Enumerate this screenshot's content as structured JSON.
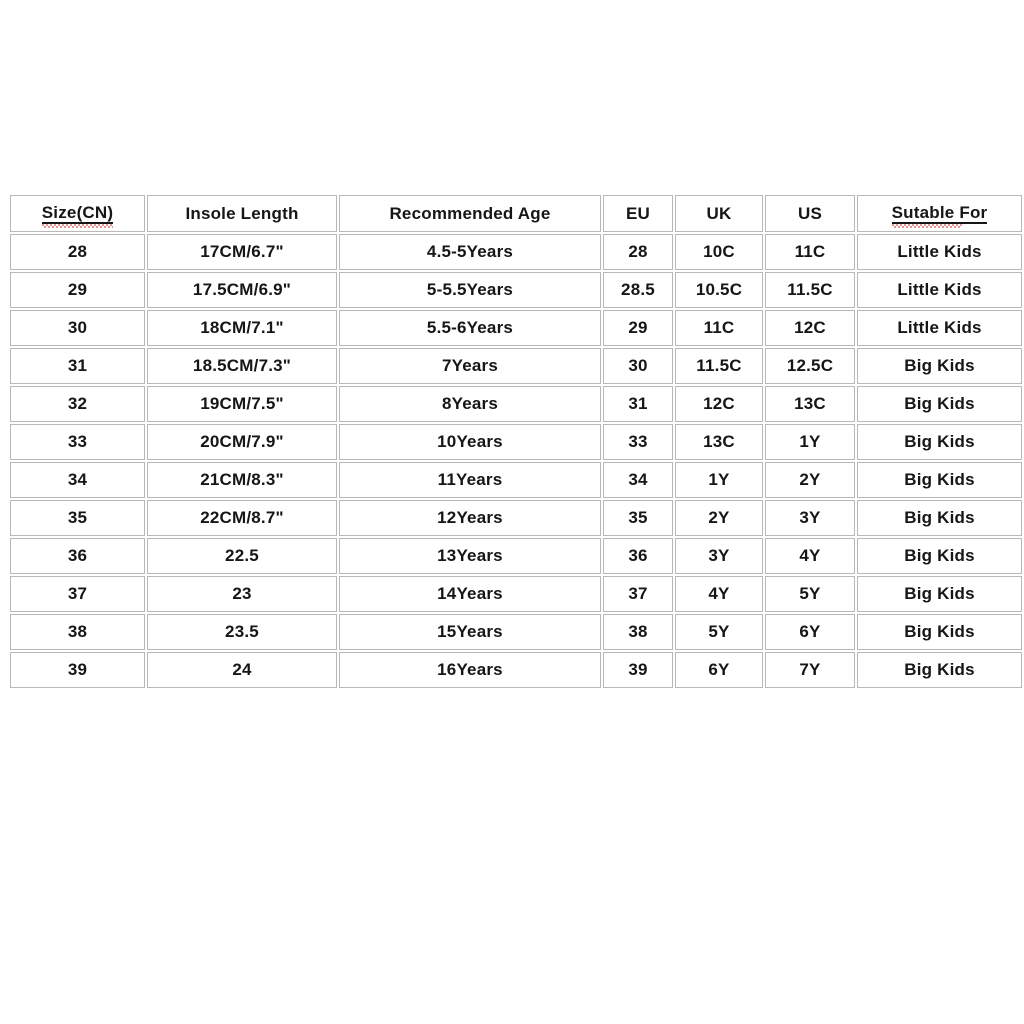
{
  "table": {
    "name": "shoe-size-conversion-chart",
    "columns": [
      {
        "key": "size_cn",
        "label": "Size(CN)",
        "style": "spell-underline"
      },
      {
        "key": "insole",
        "label": "Insole Length",
        "style": "plain"
      },
      {
        "key": "age",
        "label": "Recommended Age",
        "style": "plain"
      },
      {
        "key": "eu",
        "label": "EU",
        "style": "plain"
      },
      {
        "key": "uk",
        "label": "UK",
        "style": "plain"
      },
      {
        "key": "us",
        "label": "US",
        "style": "plain"
      },
      {
        "key": "suitable",
        "label": "Sutable For",
        "style": "spell-underline-partial"
      }
    ],
    "rows": [
      {
        "size_cn": "28",
        "insole": "17CM/6.7\"",
        "age": "4.5-5Years",
        "eu": "28",
        "uk": "10C",
        "us": "11C",
        "suitable": "Little Kids"
      },
      {
        "size_cn": "29",
        "insole": "17.5CM/6.9\"",
        "age": "5-5.5Years",
        "eu": "28.5",
        "uk": "10.5C",
        "us": "11.5C",
        "suitable": "Little Kids"
      },
      {
        "size_cn": "30",
        "insole": "18CM/7.1\"",
        "age": "5.5-6Years",
        "eu": "29",
        "uk": "11C",
        "us": "12C",
        "suitable": "Little Kids"
      },
      {
        "size_cn": "31",
        "insole": "18.5CM/7.3\"",
        "age": "7Years",
        "eu": "30",
        "uk": "11.5C",
        "us": "12.5C",
        "suitable": "Big Kids"
      },
      {
        "size_cn": "32",
        "insole": "19CM/7.5\"",
        "age": "8Years",
        "eu": "31",
        "uk": "12C",
        "us": "13C",
        "suitable": "Big Kids"
      },
      {
        "size_cn": "33",
        "insole": "20CM/7.9\"",
        "age": "10Years",
        "eu": "33",
        "uk": "13C",
        "us": "1Y",
        "suitable": "Big Kids"
      },
      {
        "size_cn": "34",
        "insole": "21CM/8.3\"",
        "age": "11Years",
        "eu": "34",
        "uk": "1Y",
        "us": "2Y",
        "suitable": "Big Kids"
      },
      {
        "size_cn": "35",
        "insole": "22CM/8.7\"",
        "age": "12Years",
        "eu": "35",
        "uk": "2Y",
        "us": "3Y",
        "suitable": "Big Kids"
      },
      {
        "size_cn": "36",
        "insole": "22.5",
        "age": "13Years",
        "eu": "36",
        "uk": "3Y",
        "us": "4Y",
        "suitable": "Big Kids"
      },
      {
        "size_cn": "37",
        "insole": "23",
        "age": "14Years",
        "eu": "37",
        "uk": "4Y",
        "us": "5Y",
        "suitable": "Big Kids"
      },
      {
        "size_cn": "38",
        "insole": "23.5",
        "age": "15Years",
        "eu": "38",
        "uk": "5Y",
        "us": "6Y",
        "suitable": "Big Kids"
      },
      {
        "size_cn": "39",
        "insole": "24",
        "age": "16Years",
        "eu": "39",
        "uk": "6Y",
        "us": "7Y",
        "suitable": "Big Kids"
      }
    ]
  },
  "colors": {
    "background": "#ffffff",
    "cell_background": "#ffffff",
    "cell_border": "#b8b8b8",
    "text": "#161616",
    "spellcheck_underline": "#d42a2a"
  }
}
